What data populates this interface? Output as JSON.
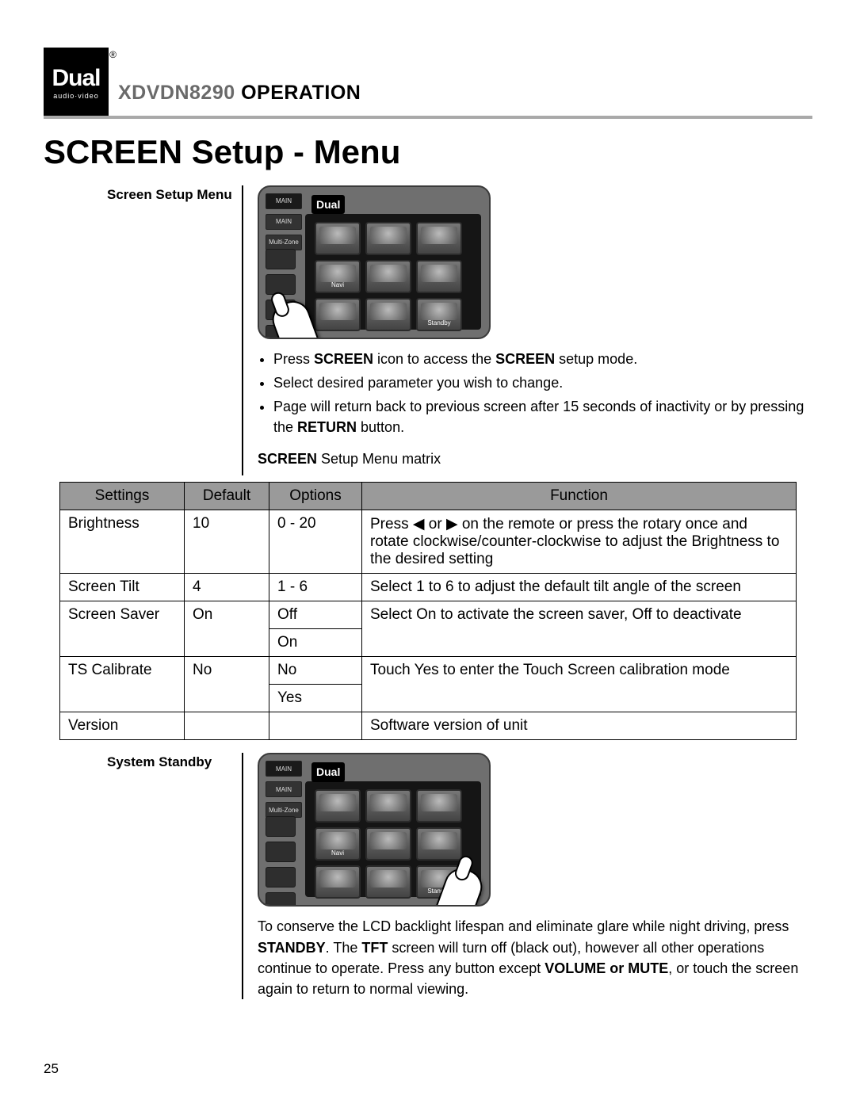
{
  "header": {
    "logo_main": "Dual",
    "logo_sub": "audio·video",
    "model": "XDVDN8290",
    "operation": " OPERATION"
  },
  "section_title": "SCREEN Setup - Menu",
  "block1_label": "Screen Setup Menu",
  "device": {
    "brand": "Dual",
    "tab1": "MAIN",
    "tab2": "MAIN",
    "tab3": "Multi-Zone"
  },
  "bullets": [
    {
      "pre": "Press ",
      "b1": "SCREEN",
      "mid": " icon to access the ",
      "b2": "SCREEN",
      "post": " setup mode."
    },
    {
      "text": "Select desired parameter you wish to change."
    },
    {
      "pre": "Page will return back to previous screen after 15 seconds of inactivity or by pressing the ",
      "b1": "RETURN",
      "post": " button."
    }
  ],
  "matrix_caption_b": "SCREEN",
  "matrix_caption_rest": " Setup Menu matrix",
  "table": {
    "headers": [
      "Settings",
      "Default",
      "Options",
      "Function"
    ],
    "rows": [
      {
        "settings": "Brightness",
        "default": "10",
        "options": "0 - 20",
        "function_pre": "Press ",
        "function_mid": " or ",
        "function_post": " on the remote or press the rotary once and rotate clockwise/counter-clockwise to adjust the Brightness to the desired setting"
      },
      {
        "settings": "Screen Tilt",
        "default": "4",
        "options": "1 - 6",
        "function": "Select 1 to 6 to adjust the default tilt angle of the screen"
      },
      {
        "settings": "Screen Saver",
        "default": "On",
        "options": "Off",
        "options2": "On",
        "function": "Select On to activate the screen saver, Off to deactivate"
      },
      {
        "settings": "TS Calibrate",
        "default": "No",
        "options": "No",
        "options2": "Yes",
        "function": "Touch Yes to enter the Touch Screen calibration mode"
      },
      {
        "settings": "Version",
        "default": "",
        "options": "",
        "function": "Software version of unit"
      }
    ]
  },
  "block2_label": "System Standby",
  "standby_text": {
    "pre": "To conserve the LCD backlight lifespan and eliminate glare while night driving, press ",
    "b1": "STANDBY",
    "mid1": ". The ",
    "b2": "TFT",
    "mid2": " screen will turn off (black out), however all other operations continue to operate. Press any button except ",
    "b3": "VOLUME or MUTE",
    "post": ", or touch the screen again to return to normal viewing."
  },
  "page_number": "25"
}
